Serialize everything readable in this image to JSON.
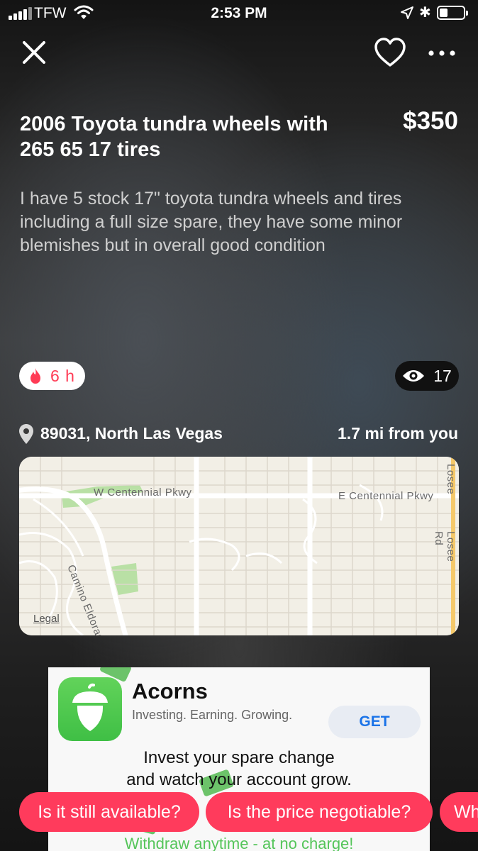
{
  "status_bar": {
    "carrier": "TFW",
    "time": "2:53 PM",
    "icons": [
      "signal-icon",
      "wifi-icon",
      "location-arrow-icon",
      "bluetooth-icon",
      "battery-icon"
    ]
  },
  "header": {
    "icons": [
      "close-icon",
      "heart-icon",
      "more-icon"
    ]
  },
  "listing": {
    "title": "2006 Toyota tundra wheels with 265 65 17 tires",
    "price": "$350",
    "description": "I have 5 stock 17\" toyota tundra wheels and tires including a full size spare, they have some minor blemishes but in overall good condition",
    "age": "6 h",
    "views": "17",
    "location": "89031, North Las Vegas",
    "distance": "1.7 mi from you"
  },
  "map": {
    "labels": {
      "w_centennial": "W Centennial Pkwy",
      "e_centennial": "E Centennial Pkwy",
      "camino": "Camino Eldorado",
      "losee_top": "Losee",
      "losee_rd": "Losee Rd"
    },
    "legal": "Legal",
    "colors": {
      "land": "#f2efe6",
      "road": "#ffffff",
      "park": "#b9e0a5",
      "highway": "#f5c96b"
    }
  },
  "ad": {
    "app_name": "Acorns",
    "tagline": "Investing. Earning. Growing.",
    "get_label": "GET",
    "body_line1": "Invest your spare change",
    "body_line2": "and watch your account grow.",
    "footer": "Withdraw anytime - at no charge!"
  },
  "quick_replies": [
    {
      "label": "Is it still available?"
    },
    {
      "label": "Is the price negotiable?"
    },
    {
      "label": "Wh"
    }
  ],
  "colors": {
    "accent": "#ff3b5c",
    "ad_green": "#55c55a",
    "get_blue": "#1a73e8"
  }
}
